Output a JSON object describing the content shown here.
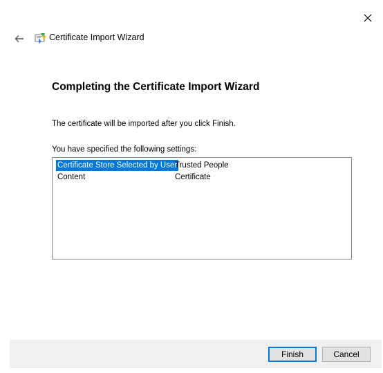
{
  "window": {
    "title": "Certificate Import Wizard",
    "icons": {
      "back": "back-arrow-icon",
      "close": "close-icon",
      "app": "certificate-icon"
    }
  },
  "page": {
    "heading": "Completing the Certificate Import Wizard",
    "description": "The certificate will be imported after you click Finish.",
    "settings_label": "You have specified the following settings:"
  },
  "settings": {
    "rows": [
      {
        "key": "Certificate Store Selected by User",
        "value": "Trusted People",
        "selected": true
      },
      {
        "key": "Content",
        "value": "Certificate",
        "selected": false
      }
    ]
  },
  "buttons": {
    "finish": "Finish",
    "cancel": "Cancel"
  },
  "colors": {
    "selection": "#0078d7",
    "footer_bg": "#f0f0f0",
    "button_bg": "#e1e1e1"
  }
}
